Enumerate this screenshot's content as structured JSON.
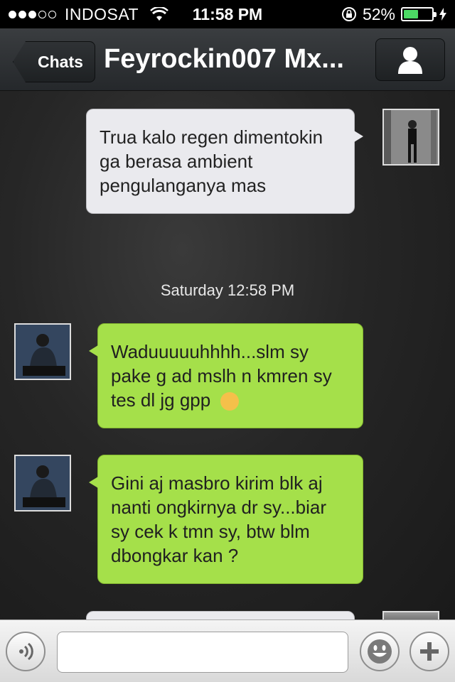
{
  "status_bar": {
    "carrier": "INDOSAT",
    "time": "11:58 PM",
    "battery_percent": "52%",
    "battery_level": 0.52,
    "signal_bars": 3
  },
  "nav": {
    "back_label": "Chats",
    "title": "Feyrockin007 Mx..."
  },
  "messages": [
    {
      "direction": "out",
      "text": "Trua kalo regen dimentokin ga berasa ambient pengulanganya mas"
    },
    {
      "direction": "in",
      "text": "Waduuuuuhhhh...slm sy pake g ad mslh n kmren sy tes dl jg gpp",
      "emoji": "flushed-face"
    },
    {
      "direction": "in",
      "text": "Gini aj masbro kirim blk aj nanti ongkirnya dr sy...biar sy cek k tmn sy, btw blm dbongkar kan ?"
    }
  ],
  "timestamp": "Saturday 12:58 PM",
  "input": {
    "value": "",
    "placeholder": ""
  },
  "colors": {
    "incoming_bubble": "#a5e04a",
    "outgoing_bubble": "#eaeaee",
    "battery_green": "#4cd964"
  }
}
